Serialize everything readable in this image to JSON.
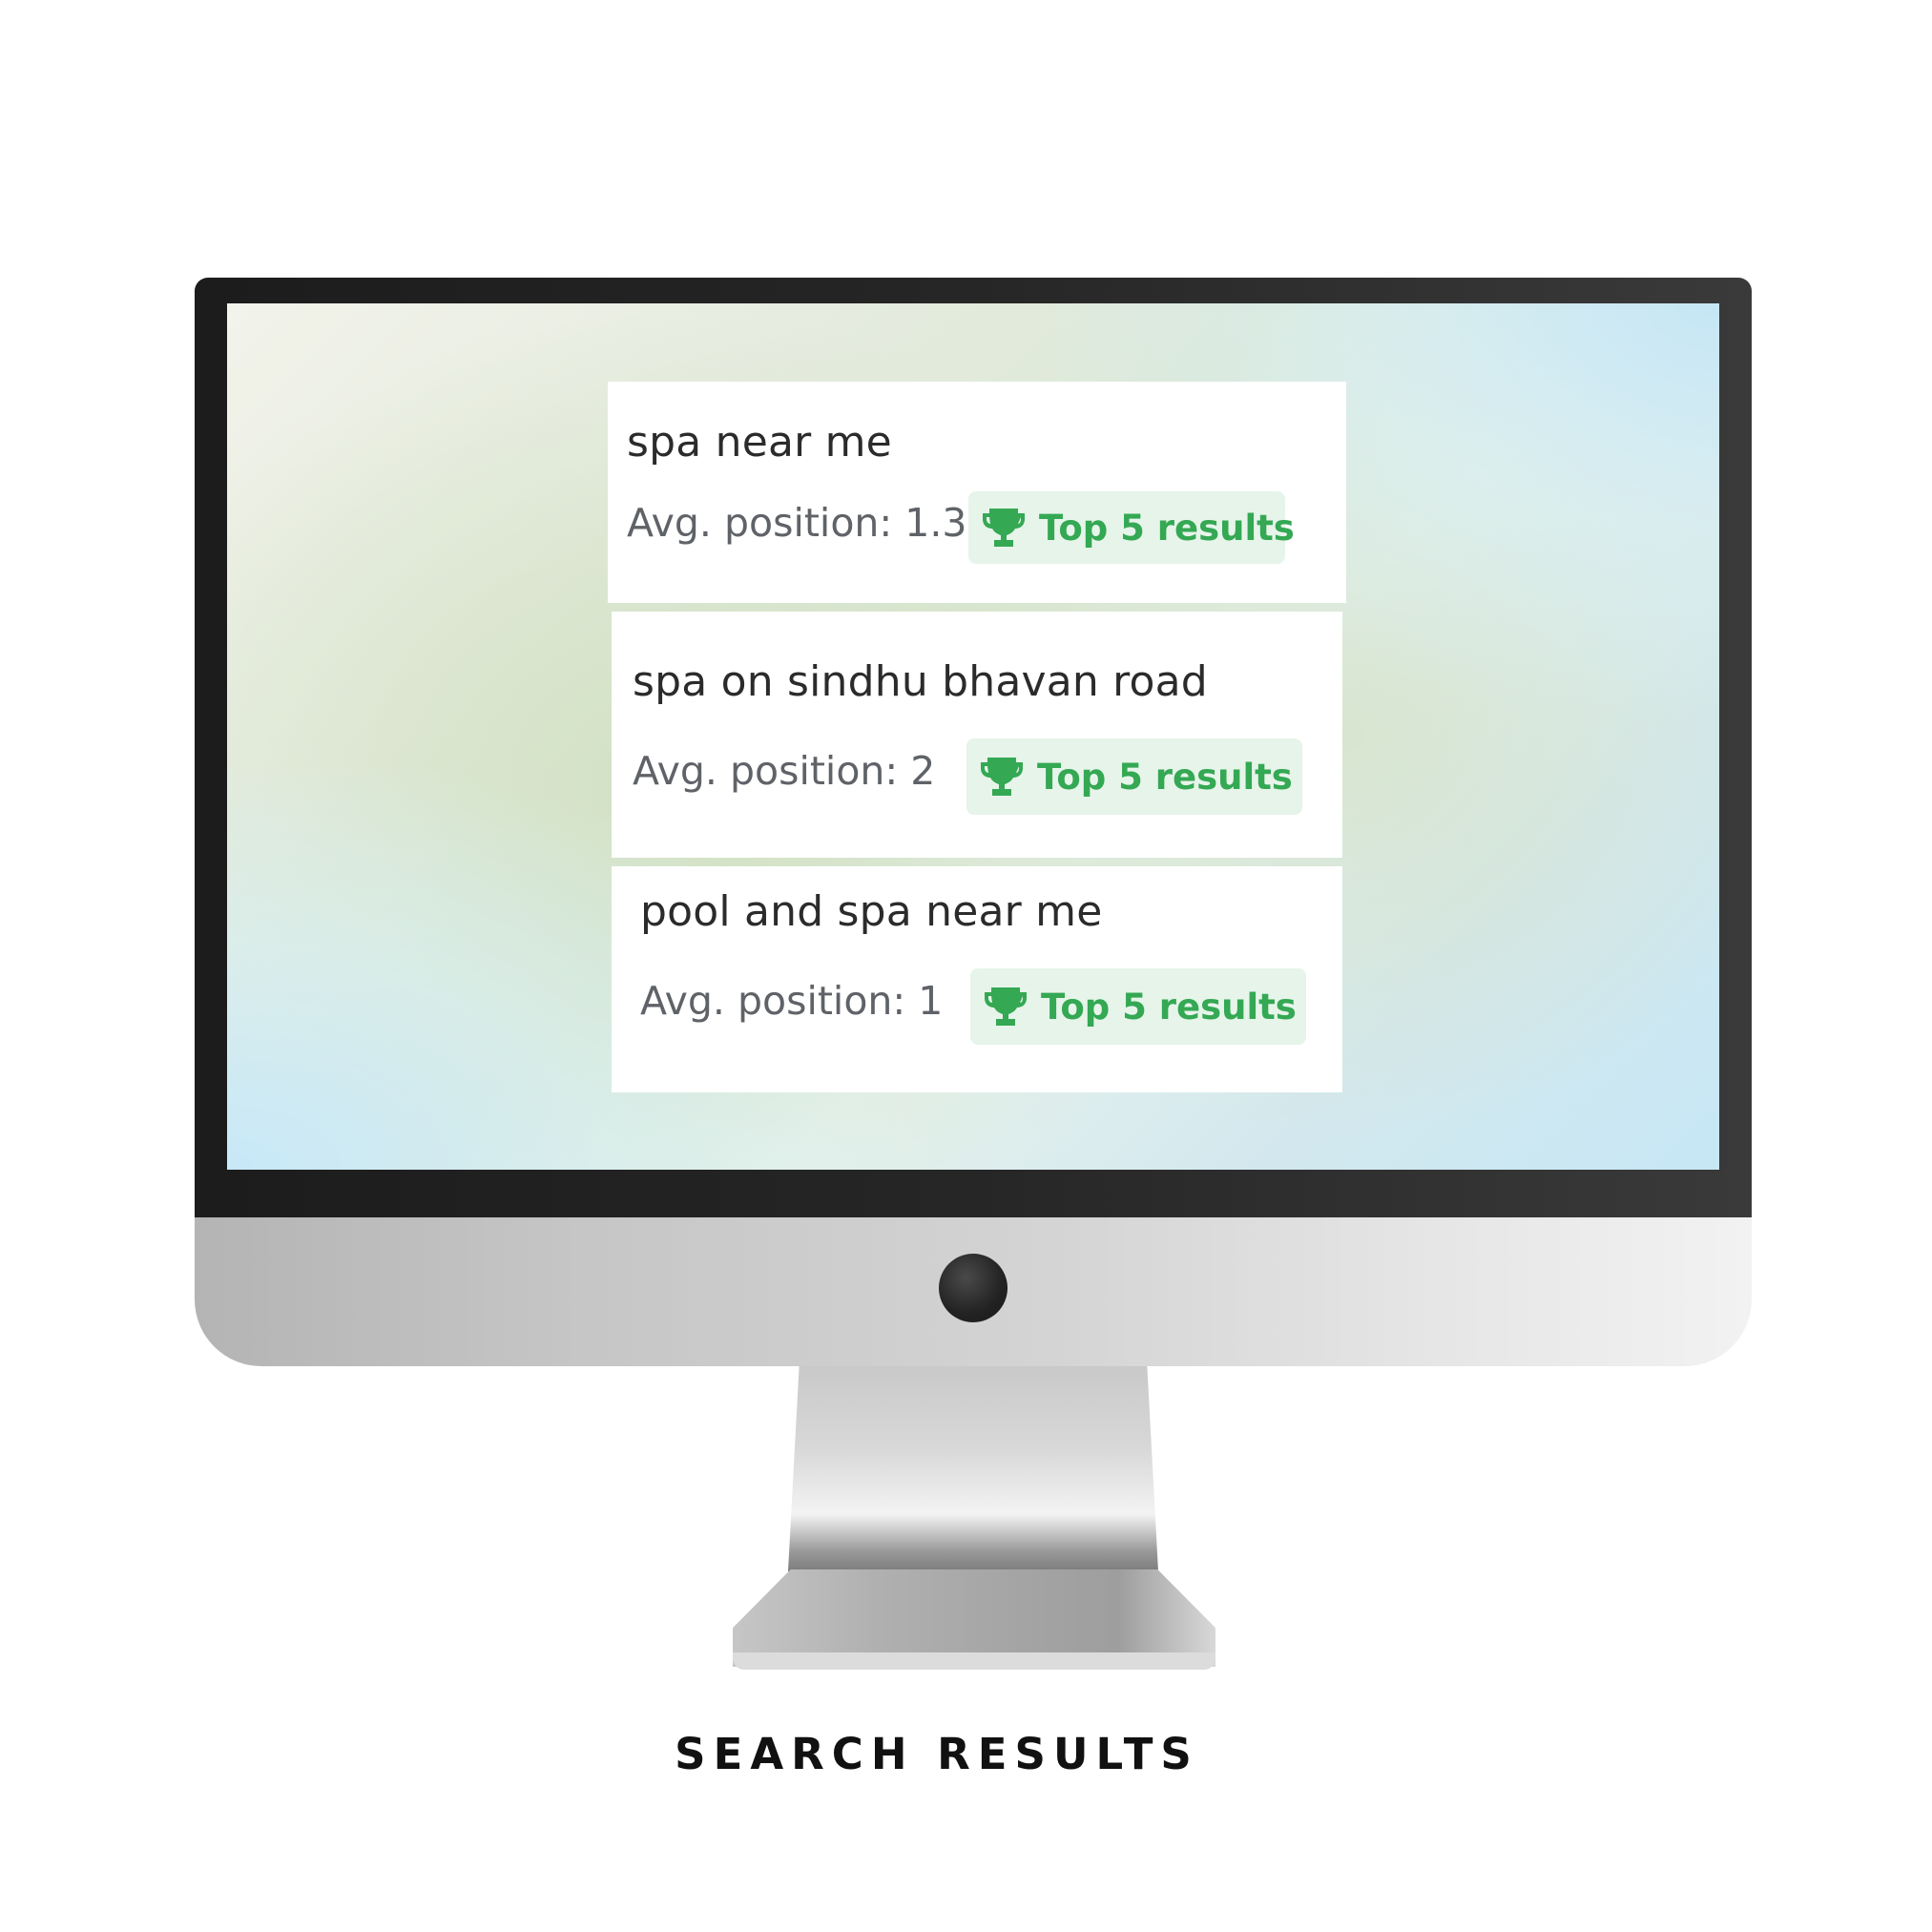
{
  "results": [
    {
      "query": "spa near me",
      "avg_position": "Avg. position: 1.3",
      "badge": "Top 5 results"
    },
    {
      "query": "spa on sindhu bhavan road",
      "avg_position": "Avg. position: 2",
      "badge": "Top 5 results"
    },
    {
      "query": "pool and spa near me",
      "avg_position": "Avg. position: 1",
      "badge": "Top 5 results"
    }
  ],
  "caption": "SEARCH RESULTS",
  "icons": {
    "badge_icon": "trophy-icon",
    "camera": "camera-icon"
  },
  "colors": {
    "badge_bg": "#e6f4ea",
    "badge_text": "#34a853",
    "query_text": "#2b2b2b",
    "avg_text": "#5f6368"
  }
}
